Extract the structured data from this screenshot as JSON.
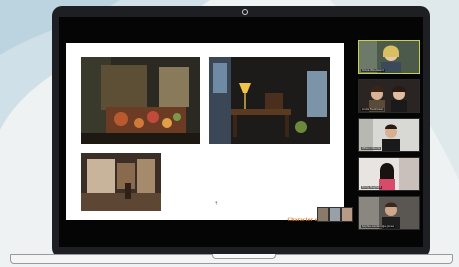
{
  "slide": {
    "caption": "Character of Place 2"
  },
  "participants": [
    {
      "name": "Olivia Woodward",
      "active": true
    },
    {
      "name": "Linda Fredriksen"
    },
    {
      "name": "Wilson Woods"
    },
    {
      "name": "Emily Mayfield"
    },
    {
      "name": "Sophie Cambridge-Jones"
    }
  ],
  "colors": {
    "accent_caption": "#d9762b",
    "active_speaker_border": "#c9d14a",
    "screen_bg": "#050505"
  }
}
